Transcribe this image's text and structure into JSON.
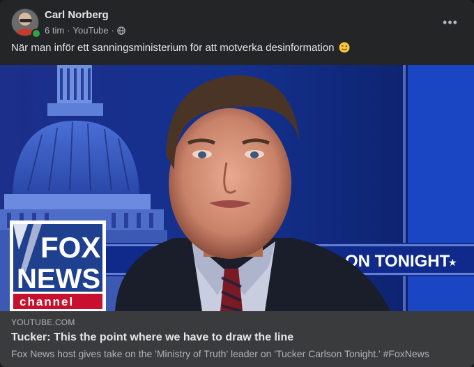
{
  "post": {
    "author": "Carl Norberg",
    "time": "6 tim",
    "source": "YouTube",
    "separator": "·",
    "text": "När man inför ett sanningsministerium för att motverka desinformation",
    "emoji_icon": "wink-emoji-icon",
    "privacy_icon": "globe-icon",
    "more_icon": "more-options-icon",
    "more_glyph": "•••"
  },
  "video_frame": {
    "logo_line1": "FOX",
    "logo_line2": "NEWS",
    "logo_line3": "channel",
    "banner_text": "ON TONIGHT",
    "banner_star": "★"
  },
  "link_preview": {
    "domain": "YOUTUBE.COM",
    "title": "Tucker: This the point where we have to draw the line",
    "description": "Fox News host gives take on the 'Ministry of Truth' leader on 'Tucker Carlson Tonight.' #FoxNews"
  },
  "colors": {
    "card_bg": "#242526",
    "preview_bg": "#3a3b3c",
    "text_primary": "#e4e6eb",
    "text_secondary": "#b0b3b8",
    "online": "#31a24c"
  }
}
